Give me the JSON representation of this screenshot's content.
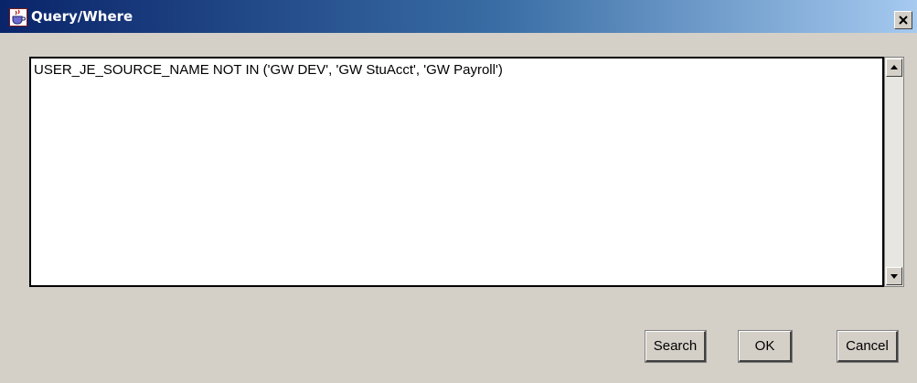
{
  "window": {
    "title": "Query/Where",
    "icon": "java-cup-icon",
    "close_icon": "close-icon"
  },
  "query": {
    "text": "USER_JE_SOURCE_NAME NOT IN ('GW DEV', 'GW StuAcct', 'GW Payroll')"
  },
  "scrollbar": {
    "up_icon": "arrow-up-icon",
    "down_icon": "arrow-down-icon"
  },
  "buttons": {
    "search": "Search",
    "ok": "OK",
    "cancel": "Cancel"
  },
  "colors": {
    "titlebar_start": "#0a246a",
    "titlebar_end": "#a6caf0",
    "dialog_bg": "#d4d0c8",
    "text_area_bg": "#ffffff"
  }
}
